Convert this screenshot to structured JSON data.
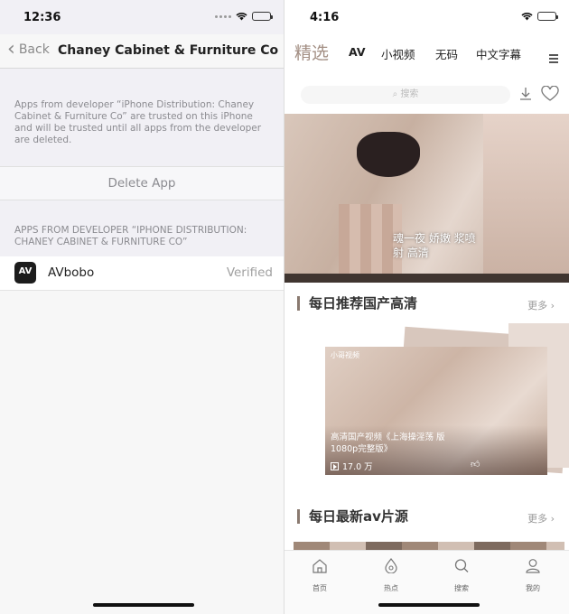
{
  "left": {
    "status_time": "12:36",
    "back_label": "Back",
    "title": "Chaney Cabinet & Furniture Co",
    "trust_text": "Apps from developer “iPhone Distribution: Chaney Cabinet & Furniture Co” are trusted on this iPhone and will be trusted until all apps from the developer are deleted.",
    "delete_label": "Delete App",
    "section_header": "APPS FROM DEVELOPER “IPHONE DISTRIBUTION: CHANEY CABINET & FURNITURE CO”",
    "app": {
      "icon_text": "AV",
      "name": "AVbobo",
      "status": "Verified"
    }
  },
  "right": {
    "status_time": "4:16",
    "tabs": [
      "精选",
      "AV",
      "小视频",
      "无码",
      "中文字幕"
    ],
    "search_placeholder": "搜索",
    "banner": {
      "caption": "魂一夜 娇嫩 浆喷射 高清"
    },
    "section1": {
      "title": "每日推荐国产高清",
      "more": "更多 ›"
    },
    "card": {
      "tag": "小哥视频",
      "title": "高清国产视频《上海操淫荡 版 1080p完整版》",
      "views": "17.0 万"
    },
    "section2": {
      "title": "每日最新av片源",
      "more": "更多 ›"
    },
    "tabbar": [
      "首页",
      "热点",
      "搜索",
      "我的"
    ]
  }
}
